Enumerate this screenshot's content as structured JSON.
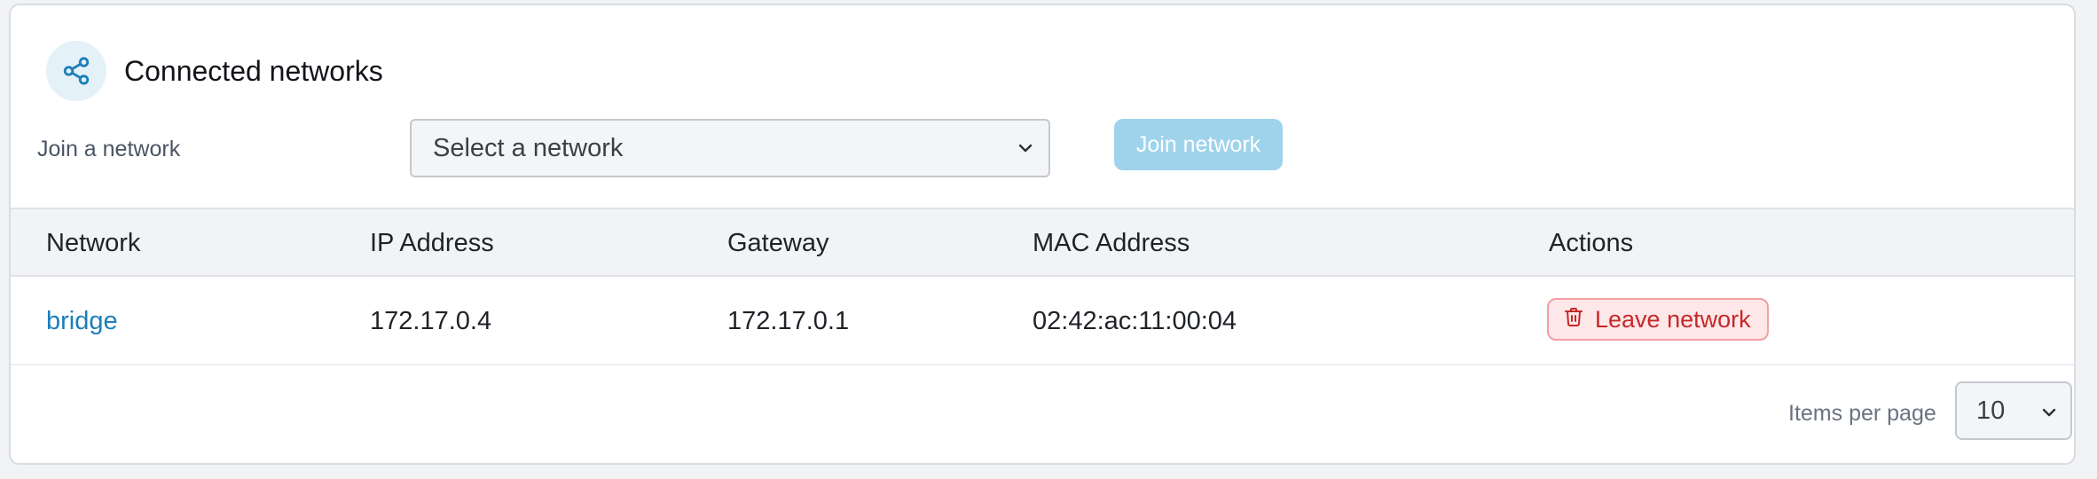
{
  "panel": {
    "title": "Connected networks",
    "icon": "share-icon",
    "accent_color": "#1b7fb8"
  },
  "join": {
    "label": "Join a network",
    "select_placeholder": "Select a network",
    "button_label": "Join network"
  },
  "table": {
    "columns": [
      "Network",
      "IP Address",
      "Gateway",
      "MAC Address",
      "Actions"
    ],
    "rows": [
      {
        "network": "bridge",
        "ip": "172.17.0.4",
        "gateway": "172.17.0.1",
        "mac": "02:42:ac:11:00:04",
        "action_label": "Leave network",
        "action_icon": "trash-icon"
      }
    ]
  },
  "pagination": {
    "items_per_page_label": "Items per page",
    "items_per_page_value": "10"
  }
}
